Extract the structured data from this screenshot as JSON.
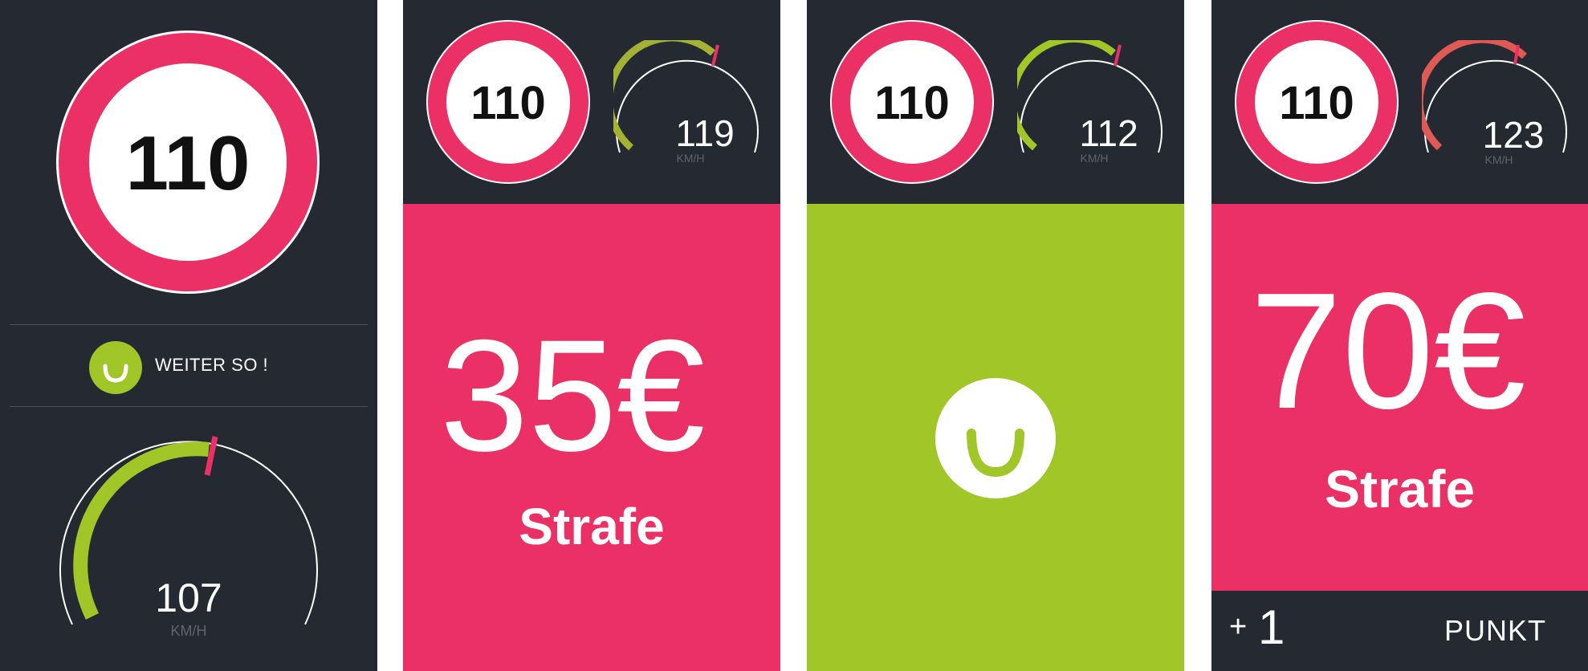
{
  "colors": {
    "background": "#252a32",
    "pink": "#ea3064",
    "green": "#a0c628",
    "red_arc": "#e05a55",
    "white": "#ffffff"
  },
  "screens": [
    {
      "speed_limit": "110",
      "status_icon": "smile-icon",
      "status_text": "WEITER SO !",
      "current_speed": "107",
      "speed_unit": "KM/H",
      "gauge": {
        "value": 107,
        "max_visible": 110,
        "arc_color": "#a0c628"
      }
    },
    {
      "speed_limit": "110",
      "current_speed": "119",
      "speed_unit": "KM/H",
      "gauge": {
        "value": 119,
        "arc_color": "#a3b232"
      },
      "fine_amount": "35€",
      "fine_label": "Strafe"
    },
    {
      "speed_limit": "110",
      "current_speed": "112",
      "speed_unit": "KM/H",
      "gauge": {
        "value": 112,
        "arc_color": "#a0c628"
      },
      "status_icon": "smile-icon"
    },
    {
      "speed_limit": "110",
      "current_speed": "123",
      "speed_unit": "KM/H",
      "gauge": {
        "value": 123,
        "arc_color": "#e05a55"
      },
      "fine_amount": "70€",
      "fine_label": "Strafe",
      "points_prefix": "+",
      "points_value": "1",
      "points_label": "PUNKT"
    }
  ]
}
